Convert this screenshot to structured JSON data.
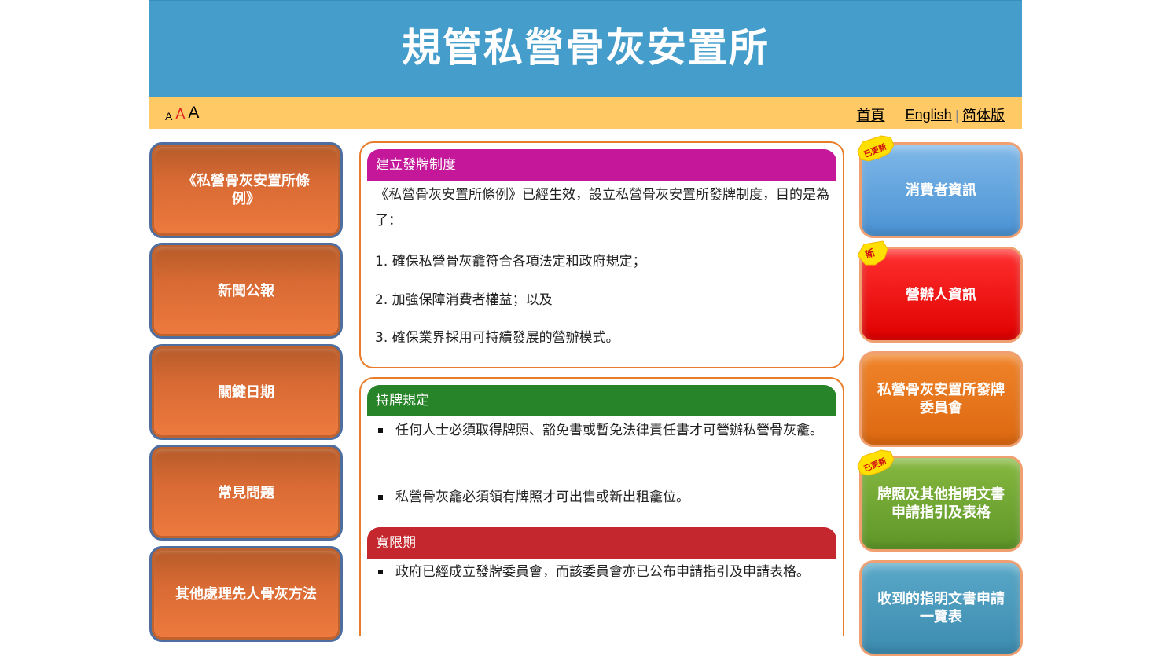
{
  "header": {
    "title": "規管私營骨灰安置所"
  },
  "toolbar": {
    "font_small": "A",
    "font_medium": "A",
    "font_large": "A",
    "home": "首頁",
    "english": "English",
    "separator": "|",
    "simplified": "简体版"
  },
  "left_nav": [
    {
      "label": "《私營骨灰安置所條例》"
    },
    {
      "label": "新聞公報"
    },
    {
      "label": "關鍵日期"
    },
    {
      "label": "常見問題"
    },
    {
      "label": "其他處理先人骨灰方法"
    }
  ],
  "right_nav": [
    {
      "label": "消費者資訊",
      "badge": "已更新"
    },
    {
      "label": "營辦人資訊",
      "badge": "新"
    },
    {
      "label": "私營骨灰安置所發牌委員會",
      "badge": ""
    },
    {
      "label": "牌照及其他指明文書申請指引及表格",
      "badge": "已更新"
    },
    {
      "label": "收到的指明文書申請一覽表",
      "badge": ""
    }
  ],
  "section1": {
    "heading": "建立發牌制度",
    "intro": "《私營骨灰安置所條例》已經生效，設立私營骨灰安置所發牌制度，目的是為了：",
    "points": [
      "1. 確保私營骨灰龕符合各項法定和政府規定；",
      "2. 加強保障消費者權益；以及",
      "3. 確保業界採用可持續發展的營辦模式。"
    ]
  },
  "section2": {
    "heading": "持牌規定",
    "bullets": [
      "任何人士必須取得牌照、豁免書或暫免法律責任書才可營辦私營骨灰龕。",
      "私營骨灰龕必須領有牌照才可出售或新出租龕位。"
    ]
  },
  "section3": {
    "heading": "寬限期",
    "bullets": [
      "政府已經成立發牌委員會，而該委員會亦已公布申請指引及申請表格。"
    ]
  },
  "colors": {
    "banner": "#449dcb",
    "toolbar": "#ffc966",
    "panel_border": "#e87c2a",
    "heading_magenta": "#c4179a",
    "heading_green": "#288428",
    "heading_red": "#c4282e"
  }
}
